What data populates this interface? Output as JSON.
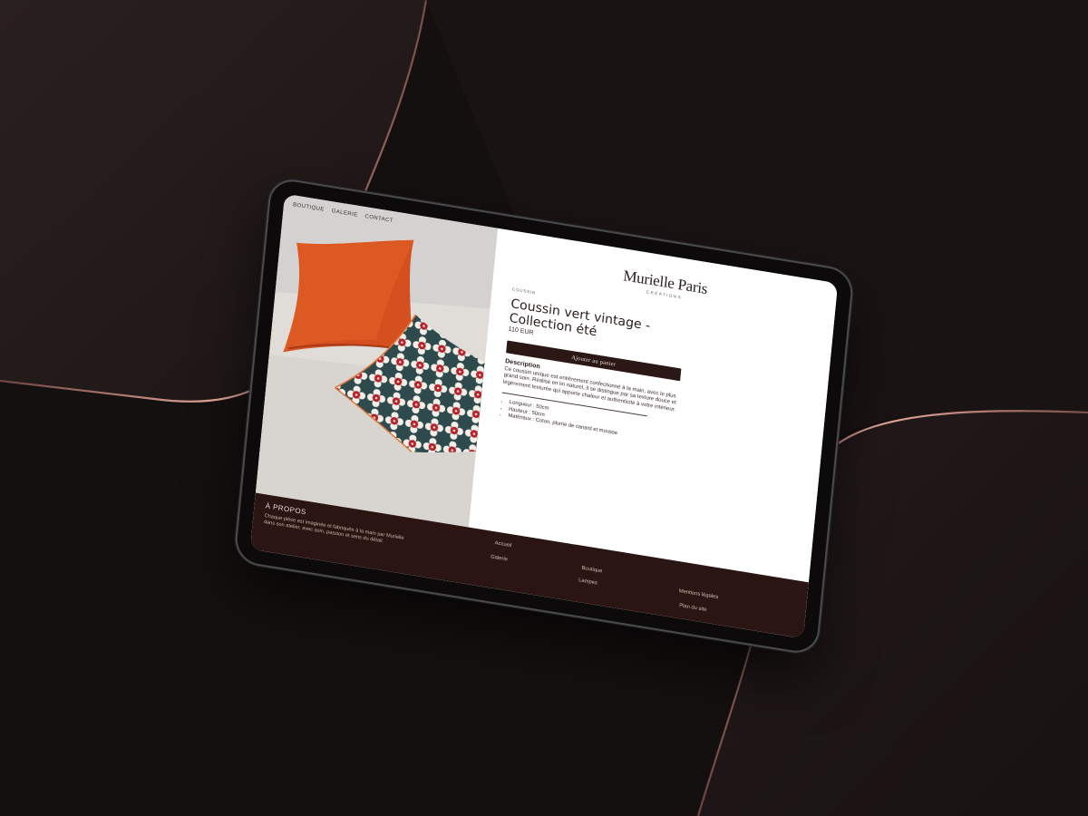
{
  "site": {
    "nav": [
      "BOUTIQUE",
      "GALERIE",
      "CONTACT"
    ],
    "brand_name": "Murielle Paris",
    "brand_sub": "CRÉATIONS"
  },
  "product": {
    "category": "COUSSIN",
    "title_line1": "Coussin vert vintage -",
    "title_line2": "Collection été",
    "price": "110 EUR",
    "add_to_cart": "Ajouter au panier",
    "description_heading": "Description",
    "description": "Ce coussin unique est entièrement confectionné à la main, avec le plus grand soin. Réalisé en lin naturel, il se distingue par sa texture douce et légèrement texturée qui apporte chaleur et authenticité à votre intérieur.",
    "specs": [
      "Longueur : 50cm",
      "Hauteur : 50cm",
      "Matériaux : Coton, plume de canard et mousse"
    ]
  },
  "footer": {
    "about_title": "À PROPOS",
    "about_text": "Chaque pièce est imaginée et fabriquée à la main par Murielle dans son atelier, avec soin, passion et sens du détail.",
    "links": [
      "Accueil",
      "Galerie",
      "Boutique",
      "Lampes",
      "Mentions légales",
      "Plan du site"
    ]
  },
  "colors": {
    "background": "#151010",
    "footer": "#2a1512",
    "button": "#2b1714",
    "accent_copper": "#c98a7e"
  }
}
